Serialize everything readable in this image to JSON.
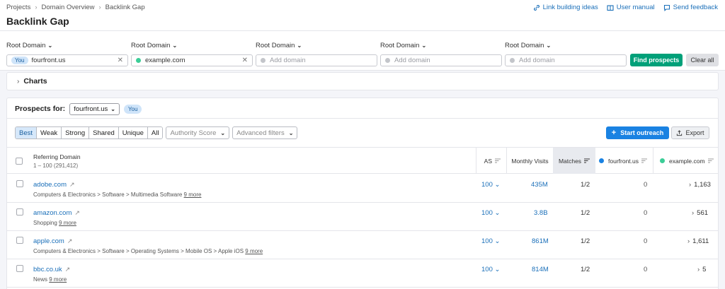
{
  "breadcrumb": [
    "Projects",
    "Domain Overview",
    "Backlink Gap"
  ],
  "title": "Backlink Gap",
  "header_links": [
    {
      "label": "Link building ideas",
      "icon": "link-icon"
    },
    {
      "label": "User manual",
      "icon": "book-icon"
    },
    {
      "label": "Send feedback",
      "icon": "chat-icon"
    }
  ],
  "domain_inputs": [
    {
      "label": "Root Domain",
      "value": "fourfront.us",
      "badge": "You",
      "clearable": true
    },
    {
      "label": "Root Domain",
      "value": "example.com",
      "dot": "#3bcd97",
      "clearable": true
    },
    {
      "label": "Root Domain",
      "placeholder": "Add domain"
    },
    {
      "label": "Root Domain",
      "placeholder": "Add domain"
    },
    {
      "label": "Root Domain",
      "placeholder": "Add domain"
    }
  ],
  "buttons": {
    "find": "Find prospects",
    "clear": "Clear all",
    "start": "Start outreach",
    "export": "Export"
  },
  "charts_label": "Charts",
  "prospects": {
    "label": "Prospects for:",
    "selected": "fourfront.us",
    "badge": "You"
  },
  "segments": [
    "Best",
    "Weak",
    "Strong",
    "Shared",
    "Unique",
    "All"
  ],
  "active_segment": "Best",
  "filters": {
    "authority": "Authority Score",
    "advanced": "Advanced filters"
  },
  "table": {
    "columns": {
      "domain": "Referring Domain",
      "range": "1 – 100 (291,412)",
      "as": "AS",
      "visits": "Monthly Visits",
      "matches": "Matches",
      "c1": "fourfront.us",
      "c2": "example.com"
    },
    "rows": [
      {
        "domain": "adobe.com",
        "cat": "Computers & Electronics > Software > Multimedia Software",
        "more": "9 more",
        "as": "100",
        "visits": "435M",
        "matches": "1/2",
        "c1": "0",
        "c2": "1,163"
      },
      {
        "domain": "amazon.com",
        "cat": "Shopping",
        "more": "9 more",
        "as": "100",
        "visits": "3.8B",
        "matches": "1/2",
        "c1": "0",
        "c2": "561"
      },
      {
        "domain": "apple.com",
        "cat": "Computers & Electronics > Software > Operating Systems > Mobile OS > Apple iOS",
        "more": "9 more",
        "as": "100",
        "visits": "861M",
        "matches": "1/2",
        "c1": "0",
        "c2": "1,611"
      },
      {
        "domain": "bbc.co.uk",
        "cat": "News",
        "more": "9 more",
        "as": "100",
        "visits": "814M",
        "matches": "1/2",
        "c1": "0",
        "c2": "5"
      }
    ]
  },
  "colors": {
    "accent": "#1a82e2",
    "green": "#00a079",
    "link": "#1a6fb9",
    "c1_dot": "#1a82e2",
    "c2_dot": "#3bcd97"
  }
}
